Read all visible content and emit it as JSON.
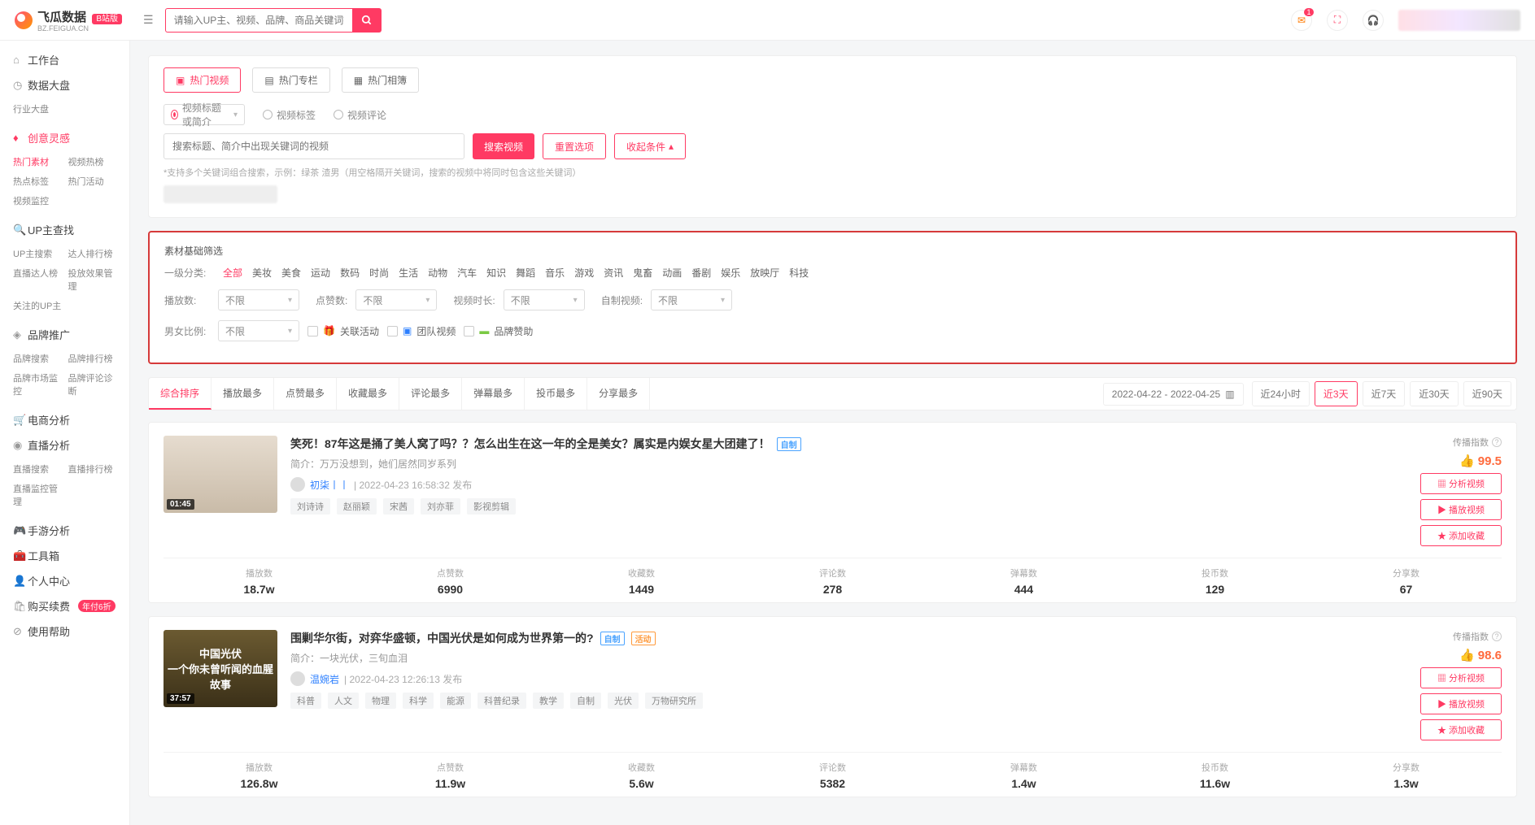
{
  "logo": {
    "name": "飞瓜数据",
    "sub": "BZ.FEIGUA.CN",
    "badge": "B站版"
  },
  "header": {
    "search_placeholder": "请输入UP主、视频、品牌、商品关键词搜索",
    "notif_badge": "1"
  },
  "sidebar": {
    "workbench": "工作台",
    "dashboard": "数据大盘",
    "dashboard_items": [
      "行业大盘"
    ],
    "creative": "创意灵感",
    "creative_items": [
      [
        "热门素材",
        "视频热榜"
      ],
      [
        "热点标签",
        "热门活动"
      ],
      [
        "视频监控",
        ""
      ]
    ],
    "upsearch": "UP主查找",
    "upsearch_items": [
      [
        "UP主搜索",
        "达人排行榜"
      ],
      [
        "直播达人榜",
        "投放效果管理"
      ],
      [
        "关注的UP主",
        ""
      ]
    ],
    "brand": "品牌推广",
    "brand_items": [
      [
        "品牌搜索",
        "品牌排行榜"
      ],
      [
        "品牌市场监控",
        "品牌评论诊断"
      ]
    ],
    "ecom": "电商分析",
    "live": "直播分析",
    "live_items": [
      [
        "直播搜索",
        "直播排行榜"
      ],
      [
        "直播监控管理",
        ""
      ]
    ],
    "mobile": "手游分析",
    "tool": "工具箱",
    "personal": "个人中心",
    "renew": "购买续费",
    "renew_badge": "年付6折",
    "help": "使用帮助"
  },
  "main_tabs": {
    "video": "热门视频",
    "column": "热门专栏",
    "album": "热门相簿"
  },
  "radios": {
    "title": "视频标题或简介",
    "tag": "视频标签",
    "comment": "视频评论"
  },
  "search2": {
    "placeholder": "搜索标题、简介中出现关键词的视频",
    "btn_search": "搜索视频",
    "btn_reset": "重置选项",
    "btn_collapse": "收起条件",
    "hint": "*支持多个关键词组合搜索，示例：绿茶 渣男（用空格隔开关键词，搜索的视频中将同时包含这些关键词）"
  },
  "filters": {
    "title": "素材基础筛选",
    "cat_label": "一级分类:",
    "cats": [
      "全部",
      "美妆",
      "美食",
      "运动",
      "数码",
      "时尚",
      "生活",
      "动物",
      "汽车",
      "知识",
      "舞蹈",
      "音乐",
      "游戏",
      "资讯",
      "鬼畜",
      "动画",
      "番剧",
      "娱乐",
      "放映厅",
      "科技"
    ],
    "play_label": "播放数:",
    "like_label": "点赞数:",
    "dur_label": "视频时长:",
    "self_label": "自制视频:",
    "gender_label": "男女比例:",
    "unlimited": "不限",
    "chk_activity": "关联活动",
    "chk_team": "团队视频",
    "chk_brand": "品牌赞助"
  },
  "sort": {
    "items": [
      "综合排序",
      "播放最多",
      "点赞最多",
      "收藏最多",
      "评论最多",
      "弹幕最多",
      "投币最多",
      "分享最多"
    ],
    "date_range": "2022-04-22 - 2022-04-25",
    "ranges": [
      "近24小时",
      "近3天",
      "近7天",
      "近30天",
      "近90天"
    ],
    "active_range_idx": 1
  },
  "cards": [
    {
      "title": "笑死！87年这是捅了美人窝了吗？？怎么出生在这一年的全是美女？属实是内娱女星大团建了！",
      "badges": [
        "自制"
      ],
      "intro_label": "简介：",
      "intro": "万万没想到，她们居然同岁系列",
      "author": "初柒丨丨",
      "time": "2022-04-23 16:58:32 发布",
      "tags": [
        "刘诗诗",
        "赵丽颖",
        "宋茜",
        "刘亦菲",
        "影视剪辑"
      ],
      "duration": "01:45",
      "spread_label": "传播指数",
      "score": "99.5",
      "actions": [
        "分析视频",
        "播放视频",
        "添加收藏"
      ],
      "stats": [
        {
          "lbl": "播放数",
          "val": "18.7w"
        },
        {
          "lbl": "点赞数",
          "val": "6990"
        },
        {
          "lbl": "收藏数",
          "val": "1449"
        },
        {
          "lbl": "评论数",
          "val": "278"
        },
        {
          "lbl": "弹幕数",
          "val": "444"
        },
        {
          "lbl": "投币数",
          "val": "129"
        },
        {
          "lbl": "分享数",
          "val": "67"
        }
      ]
    },
    {
      "title": "围剿华尔街，对弈华盛顿，中国光伏是如何成为世界第一的?",
      "badges": [
        "自制",
        "活动"
      ],
      "intro_label": "简介：",
      "intro": "一块光伏，三旬血泪",
      "author": "温婉岩",
      "time": "2022-04-23 12:26:13 发布",
      "tags": [
        "科普",
        "人文",
        "物理",
        "科学",
        "能源",
        "科普纪录",
        "教学",
        "自制",
        "光伏",
        "万物研究所"
      ],
      "duration": "37:57",
      "thumb_text": "中国光伏\n一个你未曾听闻的血腥故事",
      "spread_label": "传播指数",
      "score": "98.6",
      "actions": [
        "分析视频",
        "播放视频",
        "添加收藏"
      ],
      "stats": [
        {
          "lbl": "播放数",
          "val": "126.8w"
        },
        {
          "lbl": "点赞数",
          "val": "11.9w"
        },
        {
          "lbl": "收藏数",
          "val": "5.6w"
        },
        {
          "lbl": "评论数",
          "val": "5382"
        },
        {
          "lbl": "弹幕数",
          "val": "1.4w"
        },
        {
          "lbl": "投币数",
          "val": "11.6w"
        },
        {
          "lbl": "分享数",
          "val": "1.3w"
        }
      ]
    }
  ]
}
